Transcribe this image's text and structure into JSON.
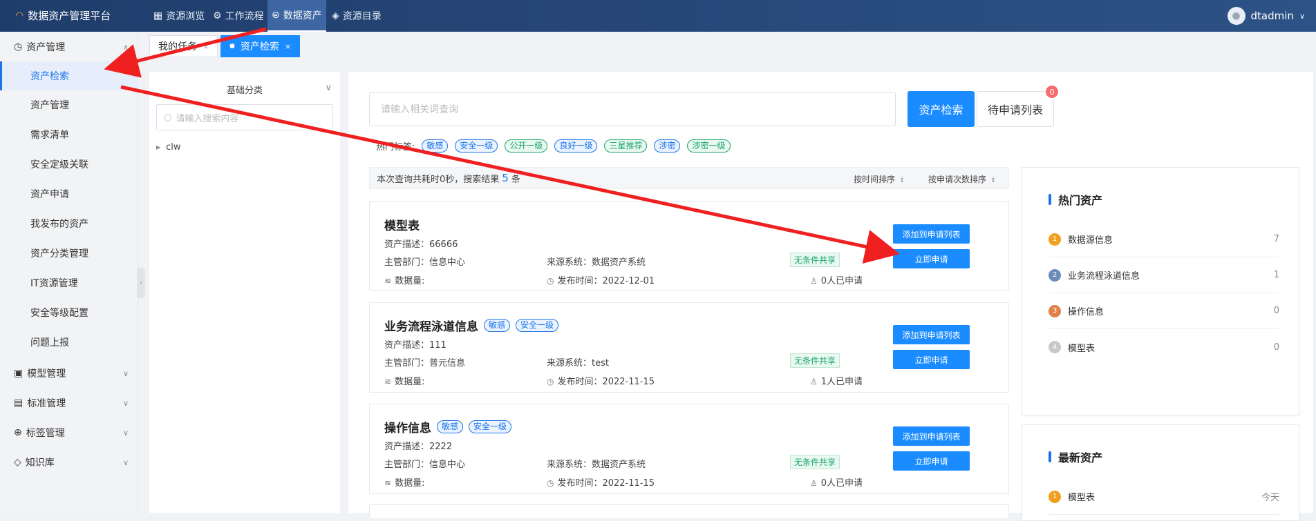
{
  "app": {
    "title": "数据资产管理平台"
  },
  "topnav": [
    {
      "label": "资源浏览",
      "icon": "grid-icon"
    },
    {
      "label": "工作流程",
      "icon": "flow-icon"
    },
    {
      "label": "数据资产",
      "icon": "asset-icon"
    },
    {
      "label": "资源目录",
      "icon": "layers-icon"
    }
  ],
  "user": {
    "name": "dtadmin"
  },
  "sidebar": {
    "group_asset": "资产管理",
    "items": [
      "资产检索",
      "资产管理",
      "需求清单",
      "安全定级关联",
      "资产申请",
      "我发布的资产",
      "资产分类管理",
      "IT资源管理",
      "安全等级配置",
      "问题上报"
    ],
    "group_model": "模型管理",
    "group_standard": "标准管理",
    "group_tag": "标签管理",
    "group_kb": "知识库"
  },
  "tabs": [
    {
      "label": "我的任务"
    },
    {
      "label": "资产检索"
    }
  ],
  "tree": {
    "title": "基础分类",
    "search_placeholder": "请输入搜索内容",
    "node": "clw"
  },
  "search": {
    "placeholder": "请输入相关词查询",
    "button": "资产检索",
    "pending_button": "待申请列表",
    "pending_count": "0"
  },
  "hot_tags": {
    "label": "热门标签:",
    "tags": [
      {
        "text": "敏感",
        "color": "blue"
      },
      {
        "text": "安全一级",
        "color": "blue"
      },
      {
        "text": "公开一级",
        "color": "green"
      },
      {
        "text": "良好一级",
        "color": "blue"
      },
      {
        "text": "三星推荐",
        "color": "green"
      },
      {
        "text": "涉密",
        "color": "blue"
      },
      {
        "text": "涉密一级",
        "color": "green"
      }
    ]
  },
  "result": {
    "prefix": "本次查询共耗时0秒，搜索结果",
    "count": "5",
    "suffix": "条",
    "sort_time": "按时间排序",
    "sort_apply": "按申请次数排序"
  },
  "cards": [
    {
      "title": "模型表",
      "tags": [],
      "desc": "资产描述：66666",
      "dept": "主管部门：信息中心",
      "src": "来源系统：数据资产系统",
      "share": "无条件共享",
      "vol": "数据量:",
      "date": "发布时间：2022-12-01",
      "applied": "0人已申请",
      "add": "添加到申请列表",
      "apply": "立即申请"
    },
    {
      "title": "业务流程泳道信息",
      "tags": [
        "敏感",
        "安全一级"
      ],
      "desc": "资产描述：111",
      "dept": "主管部门：普元信息",
      "src": "来源系统：test",
      "share": "无条件共享",
      "vol": "数据量:",
      "date": "发布时间：2022-11-15",
      "applied": "1人已申请",
      "add": "添加到申请列表",
      "apply": "立即申请"
    },
    {
      "title": "操作信息",
      "tags": [
        "敏感",
        "安全一级"
      ],
      "desc": "资产描述：2222",
      "dept": "主管部门：信息中心",
      "src": "来源系统：数据资产系统",
      "share": "无条件共享",
      "vol": "数据量:",
      "date": "发布时间：2022-11-15",
      "applied": "0人已申请",
      "add": "添加到申请列表",
      "apply": "立即申请"
    }
  ],
  "hot_assets": {
    "title": "热门资产",
    "rows": [
      {
        "rank": "1",
        "name": "数据源信息",
        "value": "7",
        "color": "#f0a020"
      },
      {
        "rank": "2",
        "name": "业务流程泳道信息",
        "value": "1",
        "color": "#6b8cb8"
      },
      {
        "rank": "3",
        "name": "操作信息",
        "value": "0",
        "color": "#e0804a"
      },
      {
        "rank": "4",
        "name": "模型表",
        "value": "0",
        "color": "#c8c8c8"
      }
    ]
  },
  "new_assets": {
    "title": "最新资产",
    "rows": [
      {
        "rank": "1",
        "name": "模型表",
        "value": "今天",
        "color": "#f0a020"
      }
    ]
  },
  "colors": {
    "primary": "#1a8cff",
    "topbar": "#1f3d6b",
    "arrow": "#f02020",
    "green": "#1aa56d"
  }
}
